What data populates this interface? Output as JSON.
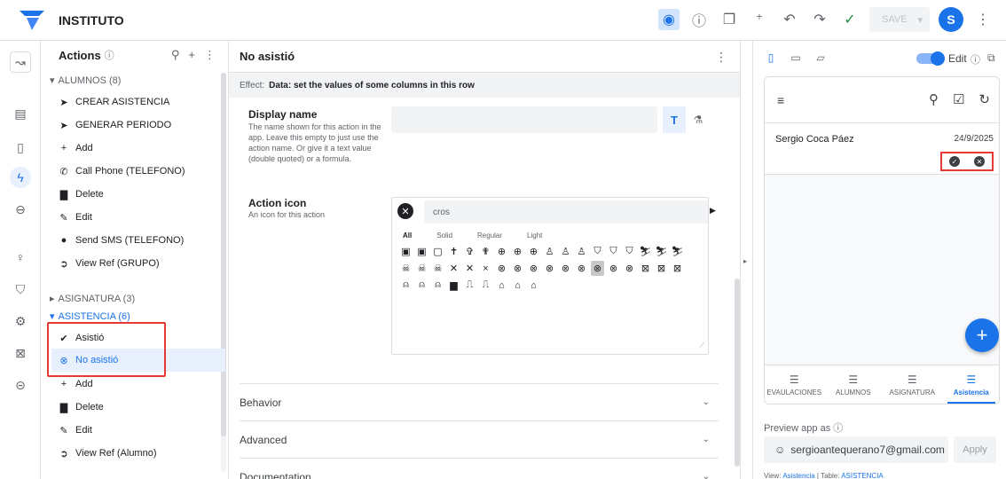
{
  "app": {
    "title": "INSTITUTO",
    "save_label": "SAVE",
    "avatar_letter": "S"
  },
  "actions_panel": {
    "title": "Actions",
    "groups": [
      {
        "label": "ALUMNOS (8)",
        "items": [
          {
            "label": "CREAR ASISTENCIA",
            "icon": "paper-plane-icon"
          },
          {
            "label": "GENERAR PERIODO",
            "icon": "paper-plane-icon"
          },
          {
            "label": "Add",
            "icon": "plus-icon"
          },
          {
            "label": "Call Phone (TELEFONO)",
            "icon": "phone-icon"
          },
          {
            "label": "Delete",
            "icon": "trash-icon"
          },
          {
            "label": "Edit",
            "icon": "edit-icon"
          },
          {
            "label": "Send SMS (TELEFONO)",
            "icon": "chat-icon"
          },
          {
            "label": "View Ref (GRUPO)",
            "icon": "arrow-circle-icon"
          }
        ]
      },
      {
        "label": "ASIGNATURA (3)",
        "items": []
      },
      {
        "label": "ASISTENCIA (6)",
        "items": [
          {
            "label": "Asistió",
            "icon": "check-circle-icon"
          },
          {
            "label": "No asistió",
            "icon": "times-circle-icon"
          },
          {
            "label": "Add",
            "icon": "plus-icon"
          },
          {
            "label": "Delete",
            "icon": "trash-icon"
          },
          {
            "label": "Edit",
            "icon": "edit-icon"
          },
          {
            "label": "View Ref (Alumno)",
            "icon": "arrow-circle-icon"
          }
        ]
      }
    ]
  },
  "editor": {
    "title": "No asistió",
    "effect_prefix": "Effect:",
    "effect_text": "Data: set the values of some columns in this row",
    "display_name": {
      "label": "Display name",
      "help": "The name shown for this action in the app. Leave this empty to just use the action name. Or give it a text value (double quoted) or a formula.",
      "value": ""
    },
    "action_icon": {
      "label": "Action icon",
      "help": "An icon for this action",
      "search": "cros",
      "filters": [
        "All",
        "Solid",
        "Regular",
        "Light"
      ]
    },
    "sections": [
      "Behavior",
      "Advanced",
      "Documentation"
    ]
  },
  "preview": {
    "edit_label": "Edit",
    "row": {
      "name": "Sergio Coca Páez",
      "date": "24/9/2025"
    },
    "nav_tabs": [
      "EVAULACIONES",
      "ALUMNOS",
      "ASIGNATURA",
      "Asistencia"
    ],
    "preview_as_label": "Preview app as",
    "email": "sergioantequerano7@gmail.com",
    "apply_label": "Apply",
    "view_prefix": "View:",
    "view_name": "Asistencia",
    "table_prefix": "Table:",
    "table_name": "ASISTENCIA"
  },
  "colors": {
    "accent": "#1a73e8",
    "highlight_box": "#e53935"
  }
}
